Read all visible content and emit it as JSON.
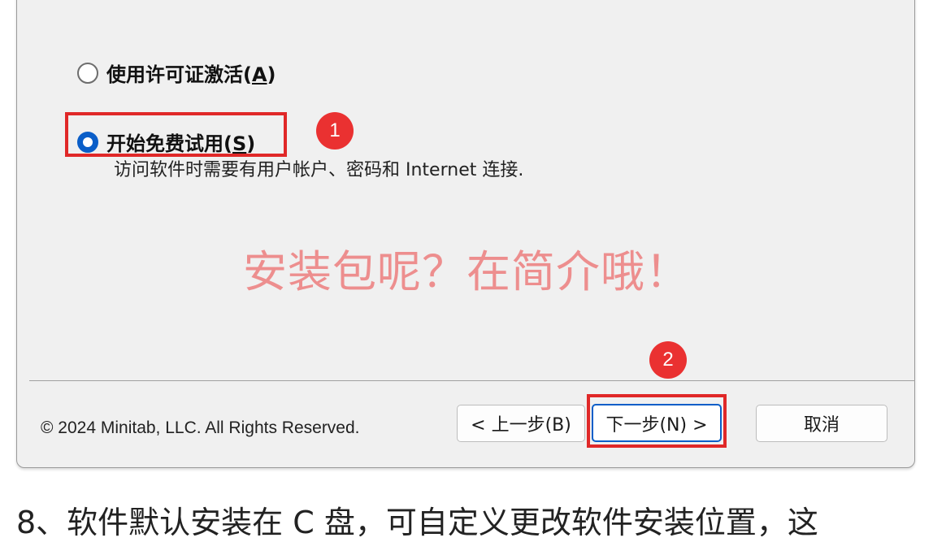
{
  "options": {
    "license": {
      "label": "使用许可证激活",
      "paren_open": "(",
      "accel": "A",
      "paren_close": ")",
      "selected": false
    },
    "trial": {
      "label": "开始免费试用",
      "paren_open": "(",
      "accel": "S",
      "paren_close": ")",
      "selected": true,
      "description": "访问软件时需要有用户帐户、密码和 Internet 连接."
    }
  },
  "annotations": {
    "badge_1": "1",
    "badge_2": "2",
    "highlight_color": "#e02828"
  },
  "watermark": "安装包呢？在简介哦！",
  "footer": {
    "copyright": "© 2024 Minitab, LLC. All Rights Reserved."
  },
  "buttons": {
    "back": "< 上一步(B)",
    "next": "下一步(N) >",
    "cancel": "取消"
  },
  "caption": "8、软件默认安装在 C 盘，可自定义更改软件安装位置，这",
  "colors": {
    "accent": "#0a5ec8",
    "dialog_bg": "#f0f0f0",
    "watermark": "#ed8e8e",
    "badge": "#ea3131"
  }
}
